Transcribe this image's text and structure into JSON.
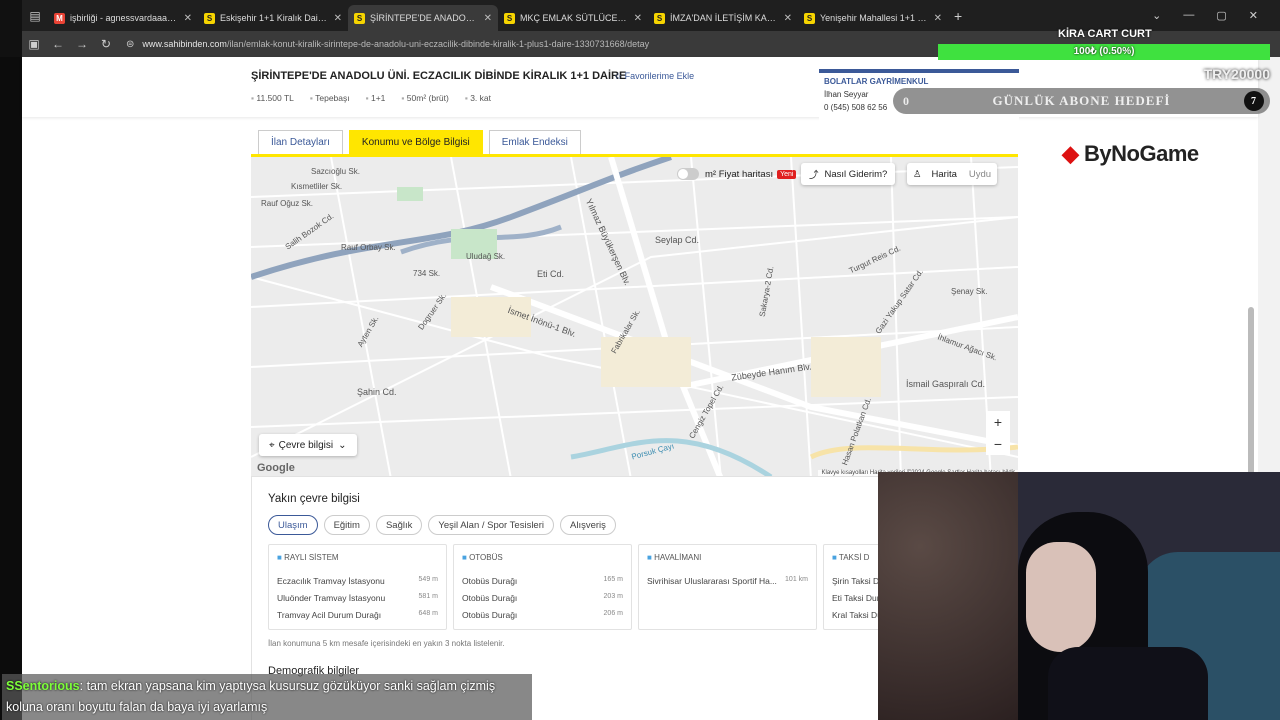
{
  "browser": {
    "tabs": [
      {
        "favicon": "M",
        "label": "işbirliği - agnessvardaaa@gmail",
        "active": false
      },
      {
        "favicon": "S",
        "label": "Eskişehir 1+1 Kiralık Daire Fiyatları",
        "active": false
      },
      {
        "favicon": "S",
        "label": "ŞİRİNTEPE'DE ANADOLU ÜNİ. E",
        "active": true
      },
      {
        "favicon": "S",
        "label": "MKÇ EMLAK SÜTLÜCEDE 1+1 K",
        "active": false
      },
      {
        "favicon": "S",
        "label": "İMZA'DAN İLETİŞİM KAPISINA Y",
        "active": false
      },
      {
        "favicon": "S",
        "label": "Yenişehir Mahallesi 1+1 Kiralık D",
        "active": false
      }
    ],
    "url_domain": "www.sahibinden.com",
    "url_path": "/ilan/emlak-konut-kiralik-sirintepe-de-anadolu-uni-eczacilik-dibinde-kiralik-1-plus1-daire-1330731668/detay"
  },
  "listing": {
    "title": "ŞİRİNTEPE'DE ANADOLU ÜNİ. ECZACILIK DİBİNDE KİRALIK 1+1 DAİRE",
    "favorite_label": "Favorilerime Ekle",
    "meta": [
      "11.500 TL",
      "Tepebaşı",
      "1+1",
      "50m² (brüt)",
      "3. kat"
    ]
  },
  "agent": {
    "company": "BOLATLAR GAYRİMENKUL",
    "name": "İlhan Seyyar",
    "phone": "0 (545) 508 62 56"
  },
  "subtabs": [
    "İlan Detayları",
    "Konumu ve Bölge Bilgisi",
    "Emlak Endeksi"
  ],
  "map": {
    "price_map_label": "m² Fiyat haritası",
    "new_badge": "Yeni",
    "directions_label": "Nasıl Giderim?",
    "view_map": "Harita",
    "view_satellite": "Uydu",
    "zoom_in": "+",
    "zoom_out": "−",
    "env_label": "Çevre bilgisi",
    "google": "Google",
    "attribution": "Klavye kısayolları   Harita verileri ©2024 Google   Şartlar   Harita hatası bildir",
    "street_labels": [
      "Sazcıoğlu Sk.",
      "Kısmetliler Sk.",
      "Rauf Oğuz Sk.",
      "Salih Bozok Cd.",
      "Rauf Orbay Sk.",
      "734 Sk.",
      "Uludağ Sk.",
      "Eti Cd.",
      "İsmet İnönü-1 Blv.",
      "Yılmaz Büyükerşen Blv.",
      "Seylap Cd.",
      "Sakarya-2 Cd.",
      "Fabrikalar Sk.",
      "Zübeyde Hanım Blv.",
      "Gazi Yakup Satar Cd.",
      "İhlamur Ağacı Sk.",
      "İsmail Gaspıralı Cd.",
      "Şahin Cd.",
      "Cengiz Topel Cd.",
      "Hasan Polatkan Cd.",
      "Porsuk Çayı",
      "Dogruer Sk.",
      "Turgut Reis Cd.",
      "Ayten Sk.",
      "Şenay Sk."
    ]
  },
  "nearby": {
    "heading": "Yakın çevre bilgisi",
    "chips": [
      "Ulaşım",
      "Eğitim",
      "Sağlık",
      "Yeşil Alan / Spor Tesisleri",
      "Alışveriş"
    ],
    "cards": [
      {
        "title": "RAYLI SİSTEM",
        "rows": [
          {
            "name": "Eczacılık Tramvay İstasyonu",
            "dist": "549 m"
          },
          {
            "name": "Uluönder Tramvay İstasyonu",
            "dist": "581 m"
          },
          {
            "name": "Tramvay Acil Durum Durağı",
            "dist": "648 m"
          }
        ]
      },
      {
        "title": "OTOBÜS",
        "rows": [
          {
            "name": "Otobüs Durağı",
            "dist": "165 m"
          },
          {
            "name": "Otobüs Durağı",
            "dist": "203 m"
          },
          {
            "name": "Otobüs Durağı",
            "dist": "206 m"
          }
        ]
      },
      {
        "title": "HAVALİMANI",
        "rows": [
          {
            "name": "Sivrihisar Uluslararası Sportif Ha...",
            "dist": "101 km"
          }
        ]
      },
      {
        "title": "TAKSİ D",
        "rows": [
          {
            "name": "Şirin Taksi D",
            "dist": ""
          },
          {
            "name": "Eti Taksi Dur",
            "dist": ""
          },
          {
            "name": "Kral Taksi Du",
            "dist": ""
          }
        ]
      }
    ],
    "footnote": "İlan konumuna 5 km mesafe içerisindeki en yakın 3 nokta listelenir.",
    "demographic_heading": "Demografik bilgiler"
  },
  "brand": "ByNoGame",
  "stream_goal": {
    "title": "KİRA CART CURT",
    "progress_text": "100₺ (0.50%)",
    "progress_fraction": 0.005,
    "amount": "TRY20000",
    "subtitle": "GÜNLÜK ABONE HEDEFİ",
    "sub_count": "0",
    "sub_target": "7"
  },
  "chat": {
    "user": "SSentorious",
    "message": ": tam ekran yapsana kim yaptıysa kusursuz gözüküyor sanki sağlam çizmiş koluna oranı boyutu falan da baya iyi ayarlamış"
  },
  "colors": {
    "brand_yellow": "#ffe600",
    "link_blue": "#3b5998",
    "goal_green": "#3fe13f",
    "chat_username": "#7dff3a"
  }
}
